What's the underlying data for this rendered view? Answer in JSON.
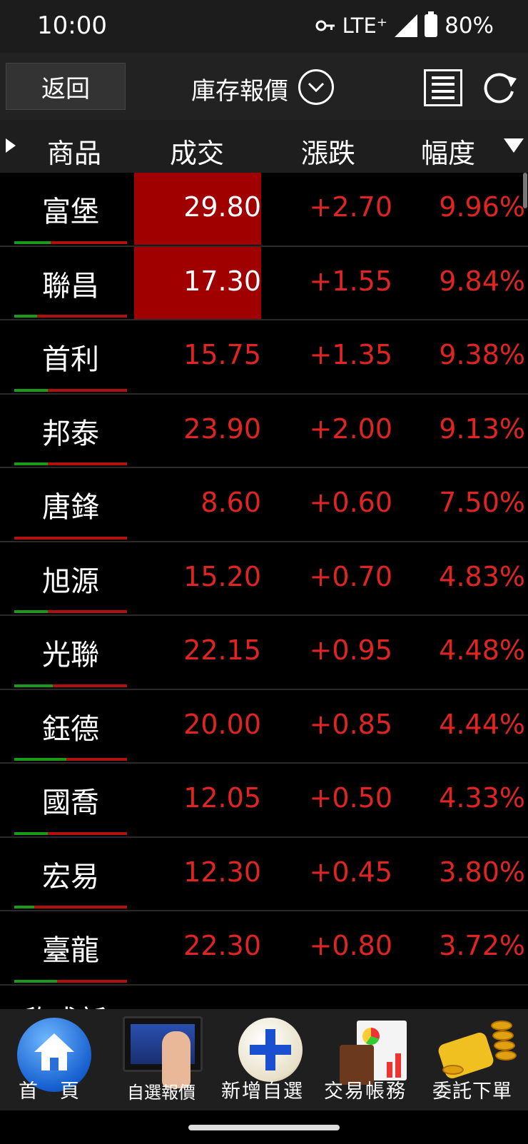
{
  "status_bar": {
    "time": "10:00",
    "network": "LTE⁺",
    "battery": "80%"
  },
  "nav": {
    "back_label": "返回",
    "title": "庫存報價"
  },
  "columns": {
    "product": "商品",
    "last": "成交",
    "change": "漲跌",
    "percent": "幅度"
  },
  "rows": [
    {
      "name": "富堡",
      "price": "29.80",
      "change": "+2.70",
      "percent": "9.96%",
      "limit_up": true,
      "green_ratio": 0.32
    },
    {
      "name": "聯昌",
      "price": "17.30",
      "change": "+1.55",
      "percent": "9.84%",
      "limit_up": true,
      "green_ratio": 0.2
    },
    {
      "name": "首利",
      "price": "15.75",
      "change": "+1.35",
      "percent": "9.38%",
      "limit_up": false,
      "green_ratio": 0.3
    },
    {
      "name": "邦泰",
      "price": "23.90",
      "change": "+2.00",
      "percent": "9.13%",
      "limit_up": false,
      "green_ratio": 0.3
    },
    {
      "name": "唐鋒",
      "price": "8.60",
      "change": "+0.60",
      "percent": "7.50%",
      "limit_up": false,
      "green_ratio": 0.0
    },
    {
      "name": "旭源",
      "price": "15.20",
      "change": "+0.70",
      "percent": "4.83%",
      "limit_up": false,
      "green_ratio": 0.3
    },
    {
      "name": "光聯",
      "price": "22.15",
      "change": "+0.95",
      "percent": "4.48%",
      "limit_up": false,
      "green_ratio": 0.34
    },
    {
      "name": "鈺德",
      "price": "20.00",
      "change": "+0.85",
      "percent": "4.44%",
      "limit_up": false,
      "green_ratio": 0.46
    },
    {
      "name": "國喬",
      "price": "12.05",
      "change": "+0.50",
      "percent": "4.33%",
      "limit_up": false,
      "green_ratio": 0.3
    },
    {
      "name": "宏易",
      "price": "12.30",
      "change": "+0.45",
      "percent": "3.80%",
      "limit_up": false,
      "green_ratio": 0.18
    },
    {
      "name": "臺龍",
      "price": "22.30",
      "change": "+0.80",
      "percent": "3.72%",
      "limit_up": false,
      "green_ratio": 0.38
    }
  ],
  "partial_row_name": "欣成新",
  "dock": {
    "home": "首　頁",
    "watchlist": "自選報價",
    "add_watch": "新增自選",
    "account": "交易帳務",
    "order": "委託下單"
  },
  "colors": {
    "up": "#e02424",
    "limit_up_bg": "#a00000",
    "green": "#1a9a1a"
  }
}
